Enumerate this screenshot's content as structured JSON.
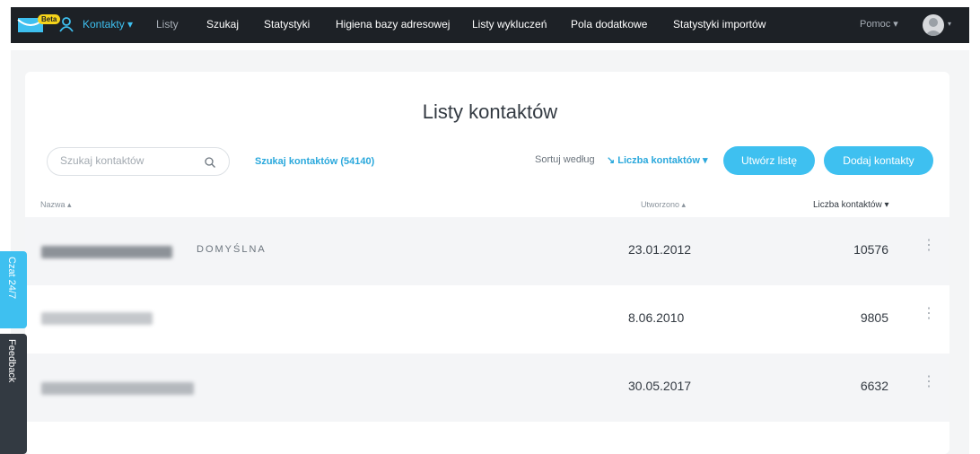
{
  "nav": {
    "beta": "Beta",
    "items": [
      {
        "label": "Kontakty ▾"
      },
      {
        "label": "Listy"
      },
      {
        "label": "Szukaj"
      },
      {
        "label": "Statystyki"
      },
      {
        "label": "Higiena bazy adresowej"
      },
      {
        "label": "Listy wykluczeń"
      },
      {
        "label": "Pola dodatkowe"
      },
      {
        "label": "Statystyki importów"
      }
    ],
    "help": "Pomoc ▾",
    "avatar_caret": "▾"
  },
  "page": {
    "title": "Listy kontaktów"
  },
  "toolbar": {
    "search_placeholder": "Szukaj kontaktów",
    "search_link": "Szukaj kontaktów (54140)",
    "sort_label": "Sortuj według",
    "sort_value": "↘ Liczba kontaktów ▾",
    "create_list": "Utwórz listę",
    "add_contacts": "Dodaj kontakty"
  },
  "table": {
    "headers": {
      "name": "Nazwa ▴",
      "created": "Utworzono ▴",
      "count": "Liczba kontaktów ▾"
    },
    "rows": [
      {
        "badge": "DOMYŚLNA",
        "created": "23.01.2012",
        "count": "10576",
        "menu": "⋮"
      },
      {
        "badge": "",
        "created": "8.06.2010",
        "count": "9805",
        "menu": "⋮"
      },
      {
        "badge": "",
        "created": "30.05.2017",
        "count": "6632",
        "menu": "⋮"
      }
    ]
  },
  "side": {
    "chat": "Czat 24/7",
    "feedback": "Feedback"
  },
  "colors": {
    "accent": "#3ec0f0",
    "nav_bg": "#1d2126",
    "beta": "#f6d31a"
  }
}
